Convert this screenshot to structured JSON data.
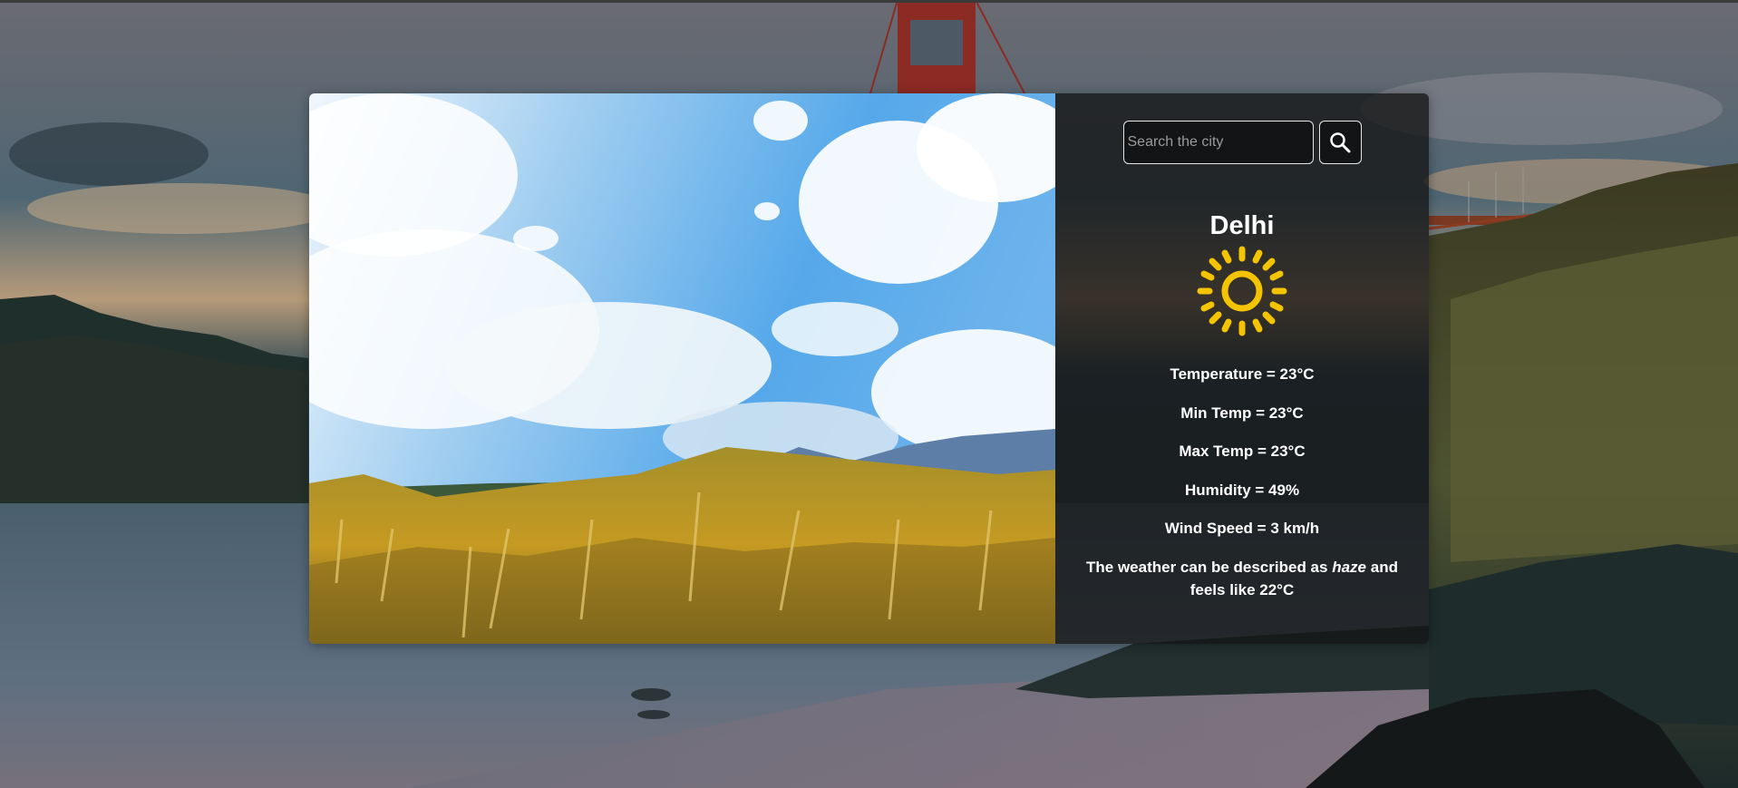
{
  "app": {
    "search": {
      "placeholder": "Search the city",
      "value": ""
    },
    "search_button_icon": "search-icon"
  },
  "weather": {
    "city": "Delhi",
    "icon": "sun-icon",
    "icon_color": "#f5c400",
    "temperature": "Temperature = 23°C",
    "min_temp": "Min Temp = 23°C",
    "max_temp": "Max Temp = 23°C",
    "humidity": "Humidity = 49%",
    "wind_speed": "Wind Speed = 3 km/h",
    "description_prefix": "The weather can be described as",
    "description_condition": "haze",
    "description_suffix": "and feels like 22°C"
  },
  "colors": {
    "panel_background": "#141414",
    "text": "#ffffff"
  }
}
